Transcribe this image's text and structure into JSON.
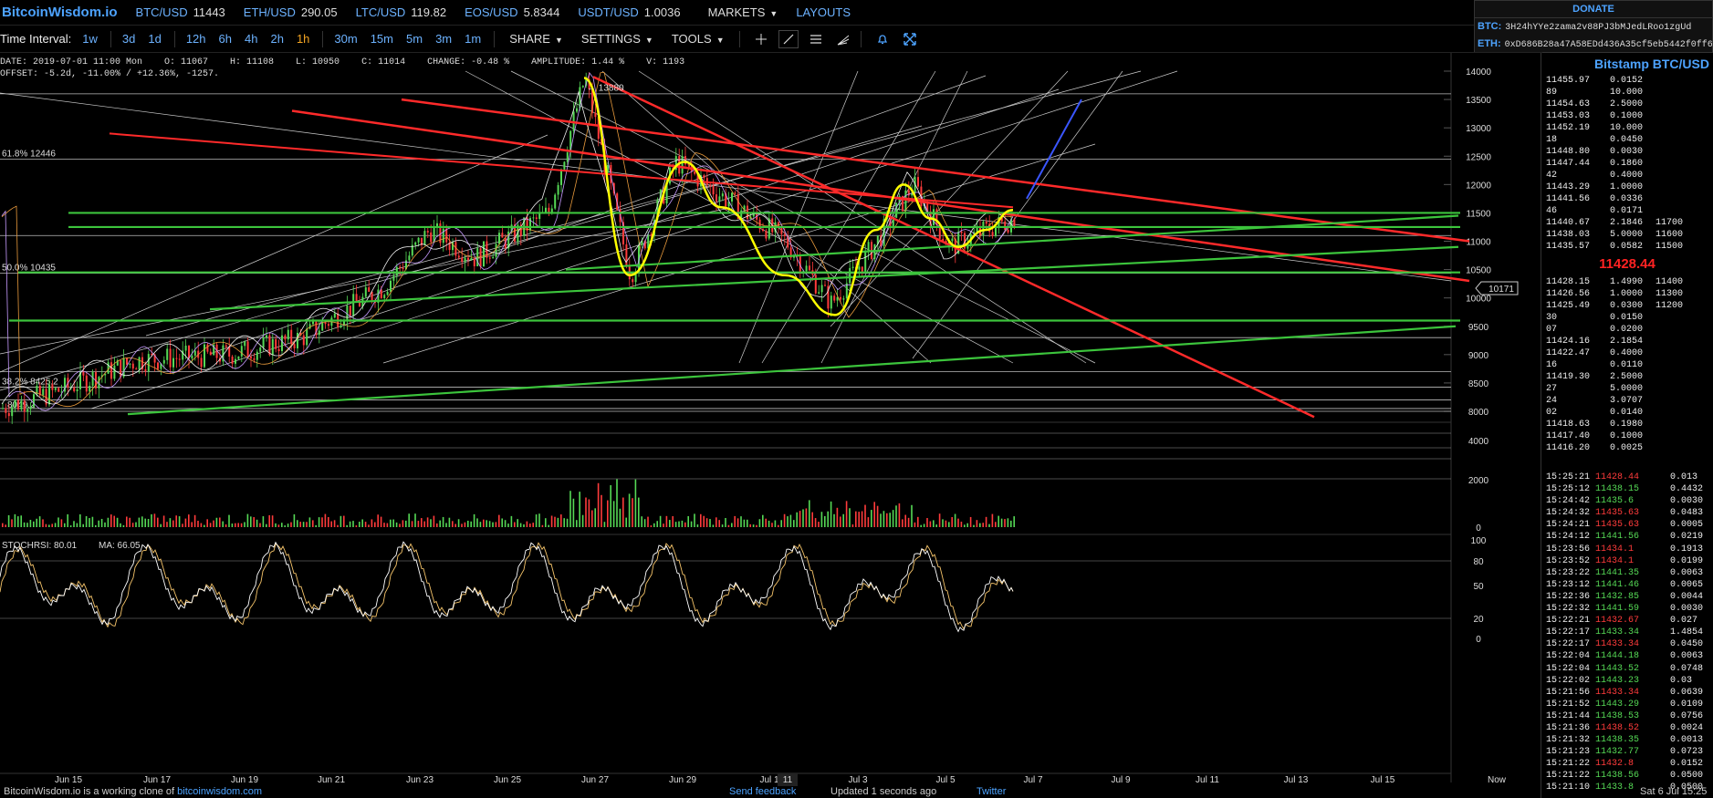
{
  "site": {
    "name": "BitcoinWisdom.io"
  },
  "tickers": [
    {
      "sym": "BTC/USD",
      "val": "11443"
    },
    {
      "sym": "ETH/USD",
      "val": "290.05"
    },
    {
      "sym": "LTC/USD",
      "val": "119.82"
    },
    {
      "sym": "EOS/USD",
      "val": "5.8344"
    },
    {
      "sym": "USDT/USD",
      "val": "1.0036"
    }
  ],
  "nav": {
    "markets": "MARKETS",
    "layouts": "LAYOUTS"
  },
  "toolbar": {
    "time_interval_label": "Time Interval:",
    "intervals": [
      "1w",
      "3d",
      "1d",
      "12h",
      "6h",
      "4h",
      "2h",
      "1h",
      "30m",
      "15m",
      "5m",
      "3m",
      "1m"
    ],
    "active_interval": "1h",
    "share": "SHARE",
    "settings": "SETTINGS",
    "tools": "TOOLS",
    "icons": [
      "crosshair-icon",
      "draw-line-icon",
      "horizontal-lines-icon",
      "fan-icon",
      "bell-icon",
      "fullscreen-icon"
    ]
  },
  "info": {
    "line1": "DATE: 2019-07-01 11:00 Mon    O: 11067    H: 11108    L: 10950    C: 11014    CHANGE: -0.48 %    AMPLITUDE: 1.44 %    V: 1193",
    "line2": "OFFSET: -5.2d, -11.00% / +12.36%, -1257."
  },
  "donate": {
    "title": "DONATE",
    "btc_label": "BTC:",
    "btc": "3H24hYYe2zama2v88PJ3bMJedLRoo1zgUd",
    "eth_label": "ETH:",
    "eth": "0xD686B28a47A58EDd436A35cf5eb5442f0ff6"
  },
  "market_title": "Bitstamp BTC/USD",
  "last_price": "11428.44",
  "asks": [
    {
      "p": "11455.97",
      "a": "0.0152",
      "s": ""
    },
    {
      "p": "89",
      "a": "10.000",
      "s": ""
    },
    {
      "p": "11454.63",
      "a": "2.5000",
      "s": ""
    },
    {
      "p": "11453.03",
      "a": "0.1000",
      "s": ""
    },
    {
      "p": "11452.19",
      "a": "10.000",
      "s": ""
    },
    {
      "p": "18",
      "a": "0.0450",
      "s": ""
    },
    {
      "p": "11448.80",
      "a": "0.0030",
      "s": ""
    },
    {
      "p": "11447.44",
      "a": "0.1860",
      "s": ""
    },
    {
      "p": "42",
      "a": "0.4000",
      "s": ""
    },
    {
      "p": "11443.29",
      "a": "1.0000",
      "s": ""
    },
    {
      "p": "11441.56",
      "a": "0.0336",
      "s": ""
    },
    {
      "p": "46",
      "a": "0.0171",
      "s": ""
    },
    {
      "p": "11440.67",
      "a": "2.1846",
      "s": "11700"
    },
    {
      "p": "11438.03",
      "a": "5.0000",
      "s": "11600"
    },
    {
      "p": "11435.57",
      "a": "0.0582",
      "s": "11500"
    }
  ],
  "bids": [
    {
      "p": "11428.15",
      "a": "1.4990",
      "s": "11400"
    },
    {
      "p": "11426.56",
      "a": "1.0000",
      "s": "11300"
    },
    {
      "p": "11425.49",
      "a": "0.0300",
      "s": "11200"
    },
    {
      "p": "30",
      "a": "0.0150",
      "s": ""
    },
    {
      "p": "07",
      "a": "0.0200",
      "s": ""
    },
    {
      "p": "11424.16",
      "a": "2.1854",
      "s": ""
    },
    {
      "p": "11422.47",
      "a": "0.4000",
      "s": ""
    },
    {
      "p": "16",
      "a": "0.0110",
      "s": ""
    },
    {
      "p": "11419.30",
      "a": "2.5000",
      "s": ""
    },
    {
      "p": "27",
      "a": "5.0000",
      "s": ""
    },
    {
      "p": "24",
      "a": "3.0707",
      "s": ""
    },
    {
      "p": "02",
      "a": "0.0140",
      "s": ""
    },
    {
      "p": "11418.63",
      "a": "0.1980",
      "s": ""
    },
    {
      "p": "11417.40",
      "a": "0.1000",
      "s": ""
    },
    {
      "p": "11416.20",
      "a": "0.0025",
      "s": ""
    }
  ],
  "trades": [
    {
      "t": "15:25:21",
      "p": "11428.44",
      "side": "sell",
      "q": "0.013"
    },
    {
      "t": "15:25:12",
      "p": "11438.15",
      "side": "buy",
      "q": "0.4432"
    },
    {
      "t": "15:24:42",
      "p": "11435.6",
      "side": "buy",
      "q": "0.0030"
    },
    {
      "t": "15:24:32",
      "p": "11435.63",
      "side": "sell",
      "q": "0.0483"
    },
    {
      "t": "15:24:21",
      "p": "11435.63",
      "side": "sell",
      "q": "0.0005"
    },
    {
      "t": "15:24:12",
      "p": "11441.56",
      "side": "buy",
      "q": "0.0219"
    },
    {
      "t": "15:23:56",
      "p": "11434.1",
      "side": "sell",
      "q": "0.1913"
    },
    {
      "t": "15:23:52",
      "p": "11434.1",
      "side": "sell",
      "q": "0.0199"
    },
    {
      "t": "15:23:22",
      "p": "11441.35",
      "side": "buy",
      "q": "0.0063"
    },
    {
      "t": "15:23:12",
      "p": "11441.46",
      "side": "buy",
      "q": "0.0065"
    },
    {
      "t": "15:22:36",
      "p": "11432.85",
      "side": "buy",
      "q": "0.0044"
    },
    {
      "t": "15:22:32",
      "p": "11441.59",
      "side": "buy",
      "q": "0.0030"
    },
    {
      "t": "15:22:21",
      "p": "11432.67",
      "side": "sell",
      "q": "0.027"
    },
    {
      "t": "15:22:17",
      "p": "11433.34",
      "side": "buy",
      "q": "1.4854"
    },
    {
      "t": "15:22:17",
      "p": "11433.34",
      "side": "sell",
      "q": "0.0450"
    },
    {
      "t": "15:22:04",
      "p": "11444.18",
      "side": "buy",
      "q": "0.0063"
    },
    {
      "t": "15:22:04",
      "p": "11443.52",
      "side": "buy",
      "q": "0.0748"
    },
    {
      "t": "15:22:02",
      "p": "11443.23",
      "side": "buy",
      "q": "0.03"
    },
    {
      "t": "15:21:56",
      "p": "11433.34",
      "side": "sell",
      "q": "0.0639"
    },
    {
      "t": "15:21:52",
      "p": "11443.29",
      "side": "buy",
      "q": "0.0109"
    },
    {
      "t": "15:21:44",
      "p": "11438.53",
      "side": "buy",
      "q": "0.0756"
    },
    {
      "t": "15:21:36",
      "p": "11438.52",
      "side": "sell",
      "q": "0.0024"
    },
    {
      "t": "15:21:32",
      "p": "11438.35",
      "side": "buy",
      "q": "0.0013"
    },
    {
      "t": "15:21:23",
      "p": "11432.77",
      "side": "buy",
      "q": "0.0723"
    },
    {
      "t": "15:21:22",
      "p": "11432.8",
      "side": "sell",
      "q": "0.0152"
    },
    {
      "t": "15:21:22",
      "p": "11438.56",
      "side": "buy",
      "q": "0.0500"
    },
    {
      "t": "15:21:10",
      "p": "11433.8",
      "side": "buy",
      "q": "0.0500"
    }
  ],
  "chart_data": {
    "type": "candlestick",
    "price_axis": {
      "ticks": [
        "14000",
        "13500",
        "13000",
        "12500",
        "12000",
        "11500",
        "11000",
        "10500",
        "10000",
        "9500",
        "9000",
        "8500",
        "8000"
      ],
      "min": 8000,
      "max": 14000
    },
    "volume_axis": {
      "ticks": [
        "4000",
        "2000",
        "0"
      ]
    },
    "rsi_axis": {
      "ticks": [
        "100",
        "80",
        "50",
        "20",
        "0"
      ]
    },
    "x_ticks": [
      "Jun 15",
      "Jun 17",
      "Jun 19",
      "Jun 21",
      "Jun 23",
      "Jun 25",
      "Jun 27",
      "Jun 29",
      "Jul 1",
      "Jul 3",
      "Jul 5",
      "Jul 7",
      "Jul 9",
      "Jul 11",
      "Jul 13",
      "Jul 15",
      "Now"
    ],
    "x_highlight": "11",
    "high_label": "13880",
    "fib_labels": [
      "61.8% 12446",
      "50.0% 10435",
      "38.2% 8425.2",
      "8049.2"
    ],
    "cursor_price": "10171",
    "indicator_label": "STOCHRSI: 80.01",
    "ma_label": "MA: 66.05",
    "colors": {
      "up": "#55d855",
      "down": "#ff3b3b",
      "trend_red": "#ff2a2a",
      "trend_green": "#3cc43c",
      "pattern": "#ffff00",
      "accent": "#4da3ff"
    }
  },
  "footer": {
    "clone_text": "BitcoinWisdom.io is a working clone of ",
    "clone_link": "bitcoinwisdom.com",
    "feedback": "Send feedback",
    "updated": "Updated 1 seconds ago",
    "twitter": "Twitter",
    "date": "Sat 6 Jul 15:25"
  }
}
